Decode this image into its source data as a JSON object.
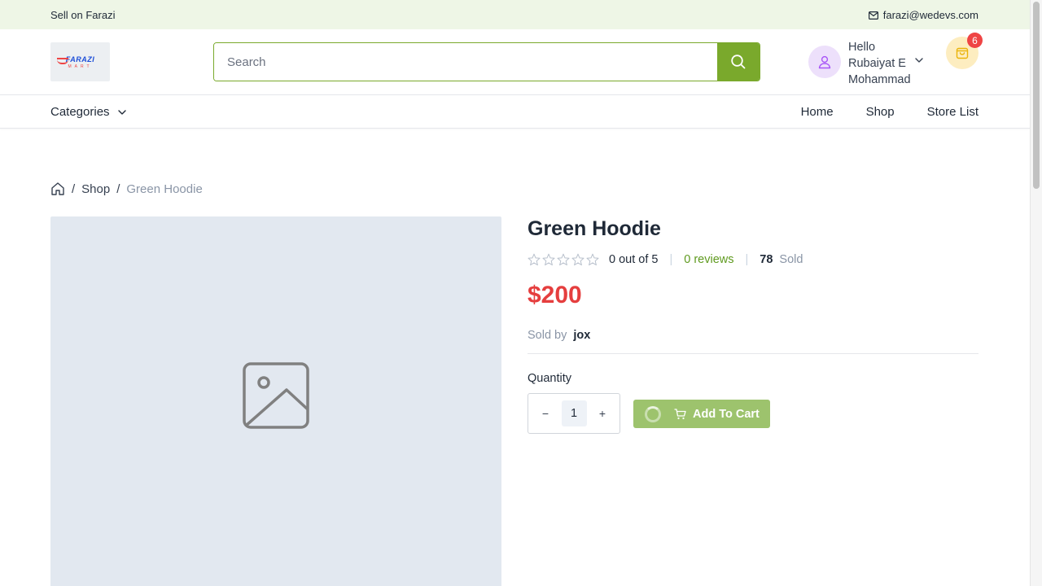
{
  "topbar": {
    "sell_label": "Sell on Farazi",
    "email": "farazi@wedevs.com"
  },
  "header": {
    "logo_text_main": "FARAZI",
    "logo_text_sub": "MART",
    "search_placeholder": "Search",
    "user_greeting": "Hello",
    "user_name": "Rubaiyat E Mohammad",
    "cart_count": "6"
  },
  "nav": {
    "categories_label": "Categories",
    "links": [
      "Home",
      "Shop",
      "Store List"
    ]
  },
  "breadcrumb": {
    "shop": "Shop",
    "current": "Green Hoodie"
  },
  "product": {
    "title": "Green Hoodie",
    "rating_text": "0 out of 5",
    "reviews_text": "0 reviews",
    "sold_count": "78",
    "sold_label": "Sold",
    "price": "$200",
    "sold_by_label": "Sold by",
    "vendor": "jox",
    "quantity_label": "Quantity",
    "quantity": "1",
    "minus_label": "−",
    "plus_label": "+",
    "add_to_cart_label": "Add To Cart",
    "star_count": 5,
    "rating_value": 0
  },
  "colors": {
    "brand_green": "#7aa92c",
    "price_red": "#e53e3e",
    "topbar_bg": "#eef6e6"
  }
}
